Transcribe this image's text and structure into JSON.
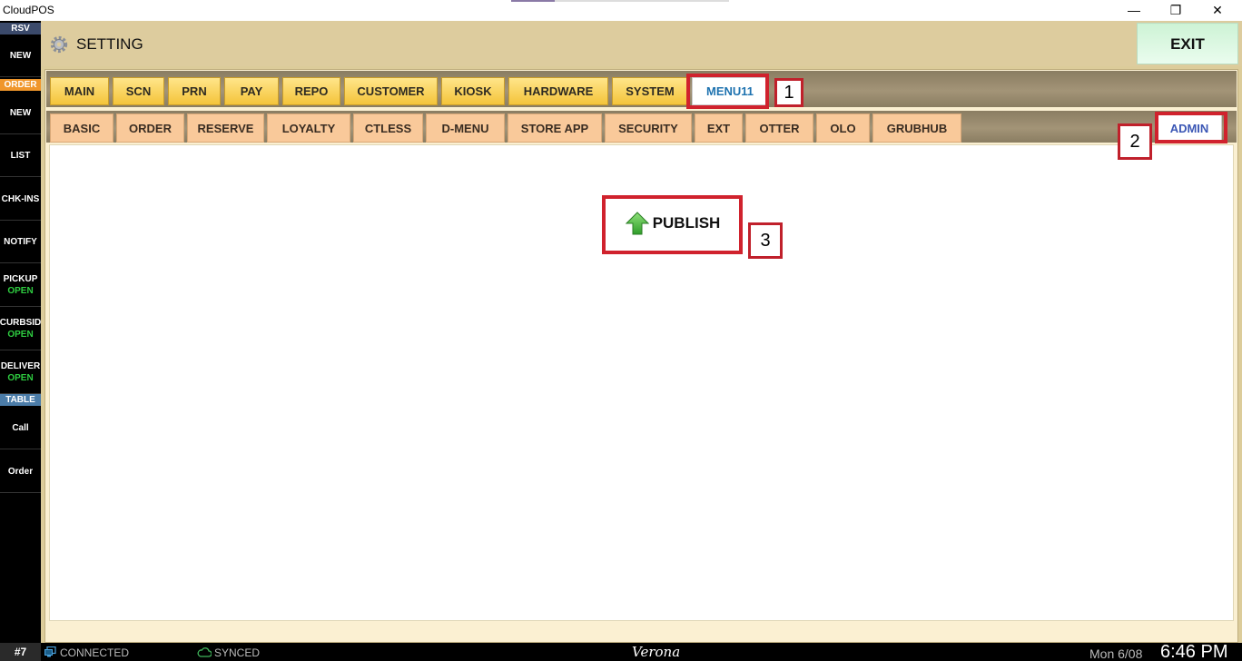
{
  "window": {
    "title": "CloudPOS",
    "minimize": "—",
    "maximize": "❐",
    "close": "✕"
  },
  "sidebar": {
    "rsv_header": "RSV",
    "rsv_new": "NEW",
    "order_header": "ORDER",
    "order_new": "NEW",
    "list": "LIST",
    "chk_ins": "CHK-INS",
    "notify": "NOTIFY",
    "pickup": {
      "label": "PICKUP",
      "status": "OPEN"
    },
    "curbside": {
      "label": "CURBSID",
      "status": "OPEN"
    },
    "delivery": {
      "label": "DELIVER",
      "status": "OPEN"
    },
    "table_header": "TABLE",
    "call": "Call",
    "order": "Order"
  },
  "header": {
    "title": "SETTING",
    "exit_label": "EXIT"
  },
  "tabs_primary": [
    "MAIN",
    "SCN",
    "PRN",
    "PAY",
    "REPO",
    "CUSTOMER",
    "KIOSK",
    "HARDWARE",
    "SYSTEM",
    "MENU11"
  ],
  "tabs_secondary": [
    "BASIC",
    "ORDER",
    "RESERVE",
    "LOYALTY",
    "CTLESS",
    "D-MENU",
    "STORE APP",
    "SECURITY",
    "EXT",
    "OTTER",
    "OLO",
    "GRUBHUB"
  ],
  "admin_tab": "ADMIN",
  "publish_label": "PUBLISH",
  "annotations": [
    "1",
    "2",
    "3"
  ],
  "status": {
    "terminal": "#7",
    "connection": "CONNECTED",
    "sync": "SYNCED",
    "store": "Verona",
    "date": "Mon 6/08",
    "time": "6:46 PM"
  },
  "colors": {
    "accent_tab": "#f4c43a",
    "sub_tab": "#f9c99a",
    "exit_bg": "#d8f6de",
    "annotation": "#d0222d",
    "open_status": "#2ecc40"
  }
}
